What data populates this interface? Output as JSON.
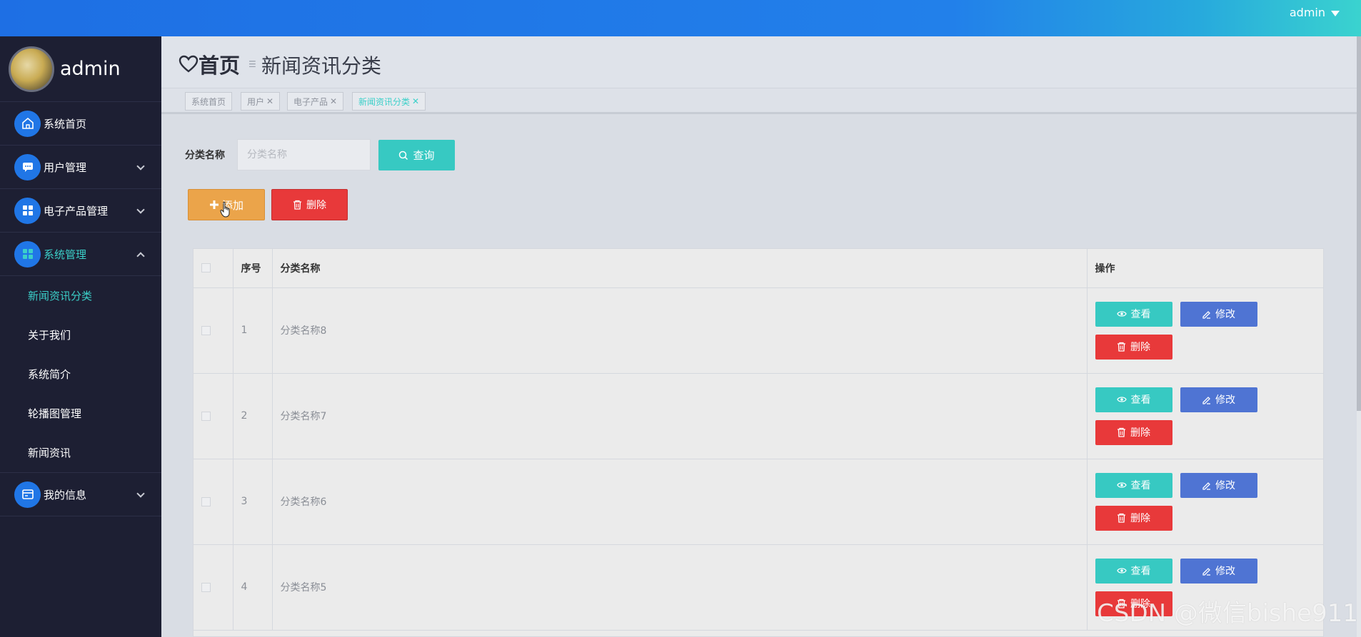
{
  "topbar": {
    "user": "admin"
  },
  "sidebar": {
    "profile_name": "admin",
    "menu": [
      {
        "label": "系统首页",
        "icon": "home-icon"
      },
      {
        "label": "用户管理",
        "icon": "chat-icon"
      },
      {
        "label": "电子产品管理",
        "icon": "grid-icon"
      },
      {
        "label": "系统管理",
        "icon": "grid-icon"
      },
      {
        "label": "我的信息",
        "icon": "card-icon"
      }
    ],
    "submenu": [
      "新闻资讯分类",
      "关于我们",
      "系统简介",
      "轮播图管理",
      "新闻资讯"
    ]
  },
  "header": {
    "home": "首页",
    "sep": "☰",
    "title": "新闻资讯分类"
  },
  "tabs": [
    "系统首页",
    "用户",
    "电子产品",
    "新闻资讯分类"
  ],
  "search": {
    "label": "分类名称",
    "placeholder": "分类名称",
    "button": "查询"
  },
  "actions": {
    "add": "添加",
    "delete": "删除"
  },
  "table": {
    "headers": [
      "序号",
      "分类名称",
      "操作"
    ],
    "rows": [
      {
        "idx": "1",
        "name": "分类名称8"
      },
      {
        "idx": "2",
        "name": "分类名称7"
      },
      {
        "idx": "3",
        "name": "分类名称6"
      },
      {
        "idx": "4",
        "name": "分类名称5"
      }
    ],
    "ops": {
      "view": "查看",
      "edit": "修改",
      "delete": "删除"
    }
  },
  "watermark": "CSDN @微信bishe911",
  "colors": {
    "accent": "#3bd0c9",
    "primary": "#2076e6",
    "danger": "#e8393a",
    "warning": "#eba44a",
    "edit": "#4f74d3",
    "sidebar": "#1d1f33"
  }
}
